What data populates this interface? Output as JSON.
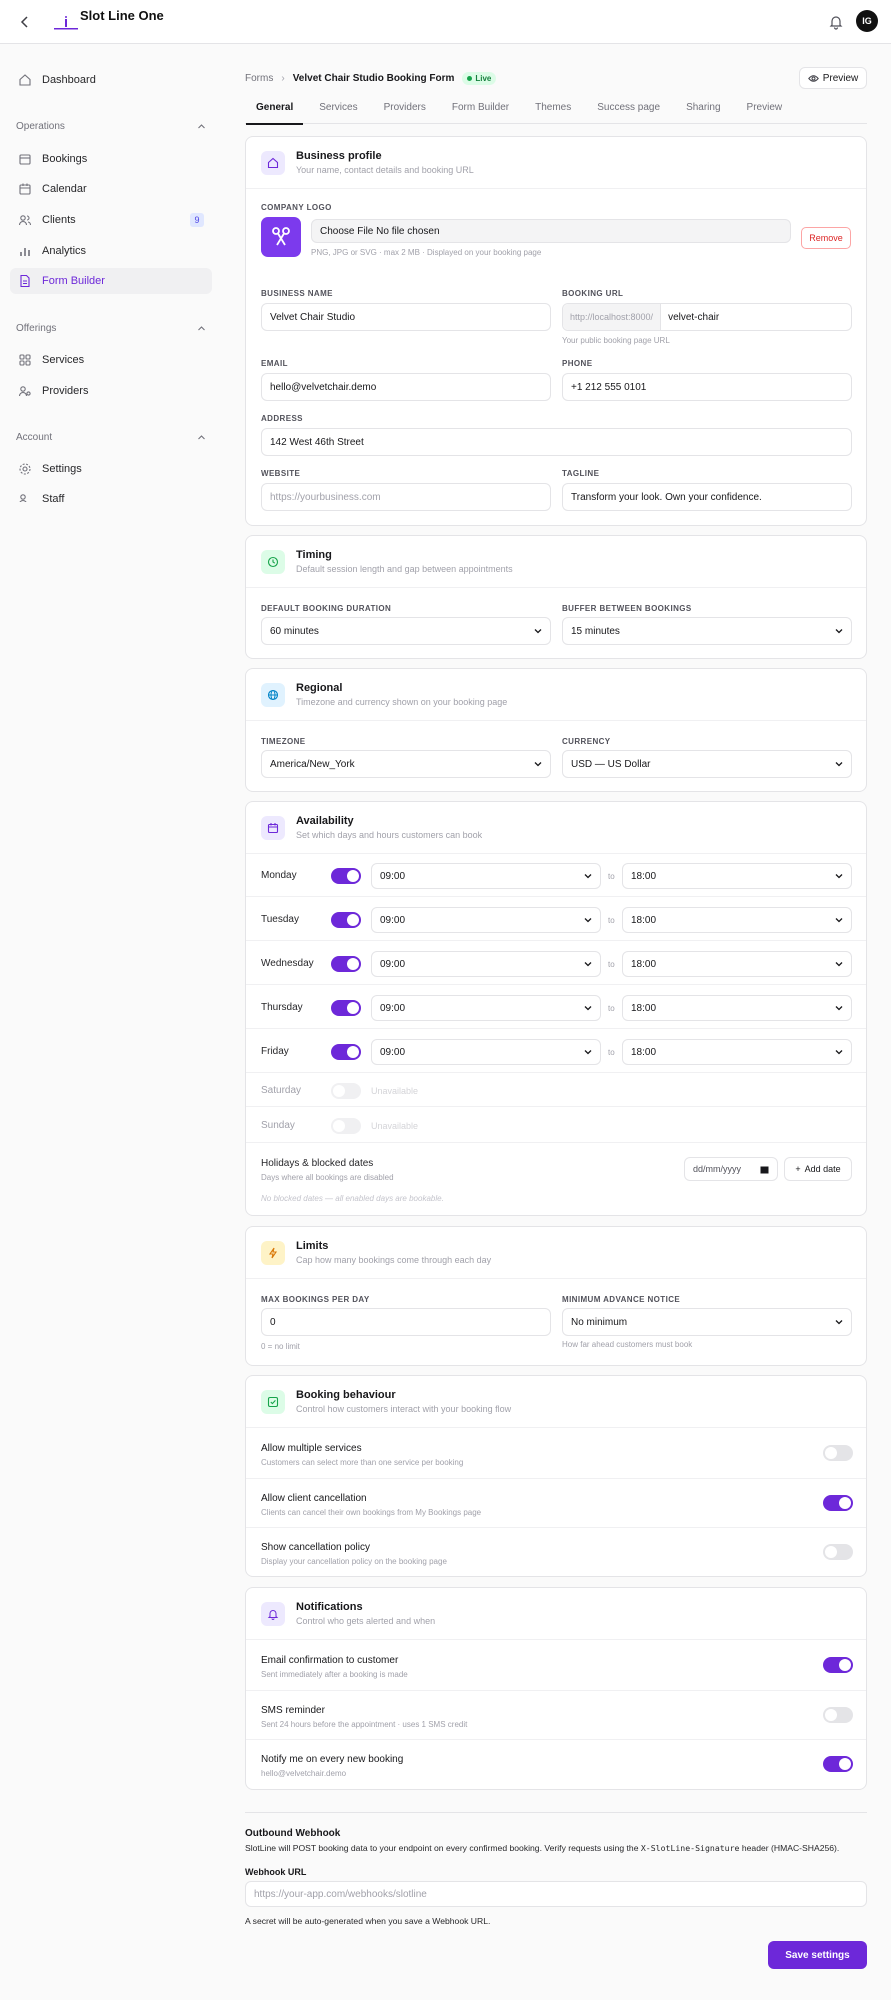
{
  "app": {
    "title": "Slot Line One",
    "avatar": "IG"
  },
  "sidebar": {
    "dashboard": "Dashboard",
    "operations": {
      "label": "Operations",
      "items": [
        {
          "label": "Bookings"
        },
        {
          "label": "Calendar"
        },
        {
          "label": "Clients",
          "badge": "9"
        },
        {
          "label": "Analytics"
        },
        {
          "label": "Form Builder"
        }
      ]
    },
    "offerings": {
      "label": "Offerings",
      "items": [
        {
          "label": "Services"
        },
        {
          "label": "Providers"
        }
      ]
    },
    "account": {
      "label": "Account",
      "items": [
        {
          "label": "Settings"
        },
        {
          "label": "Staff"
        }
      ]
    }
  },
  "header": {
    "breadcrumb_root": "Forms",
    "breadcrumb_current": "Velvet Chair Studio Booking Form",
    "status": "Live",
    "preview_button": "Preview",
    "tabs": [
      "General",
      "Services",
      "Providers",
      "Form Builder",
      "Themes",
      "Success page",
      "Sharing",
      "Preview"
    ]
  },
  "business": {
    "title": "Business profile",
    "subtitle": "Your name, contact details and booking URL",
    "logo_label": "COMPANY LOGO",
    "file_text": "Choose File No file chosen",
    "file_hint": "PNG, JPG or SVG · max 2 MB · Displayed on your booking page",
    "remove": "Remove",
    "name_label": "BUSINESS NAME",
    "name_value": "Velvet Chair Studio",
    "url_label": "BOOKING URL",
    "url_prefix": "http://localhost:8000/",
    "url_value": "velvet-chair",
    "url_hint": "Your public booking page URL",
    "email_label": "EMAIL",
    "email_value": "hello@velvetchair.demo",
    "phone_label": "PHONE",
    "phone_value": "+1 212 555 0101",
    "address_label": "ADDRESS",
    "address_value": "142 West 46th Street",
    "website_label": "WEBSITE",
    "website_placeholder": "https://yourbusiness.com",
    "tagline_label": "TAGLINE",
    "tagline_value": "Transform your look. Own your confidence."
  },
  "timing": {
    "title": "Timing",
    "subtitle": "Default session length and gap between appointments",
    "duration_label": "DEFAULT BOOKING DURATION",
    "duration_value": "60 minutes",
    "buffer_label": "BUFFER BETWEEN BOOKINGS",
    "buffer_value": "15 minutes"
  },
  "regional": {
    "title": "Regional",
    "subtitle": "Timezone and currency shown on your booking page",
    "tz_label": "TIMEZONE",
    "tz_value": "America/New_York",
    "cur_label": "CURRENCY",
    "cur_value": "USD — US Dollar"
  },
  "availability": {
    "title": "Availability",
    "subtitle": "Set which days and hours customers can book",
    "to": "to",
    "unavailable": "Unavailable",
    "days": [
      {
        "day": "Monday",
        "start": "09:00",
        "end": "18:00"
      },
      {
        "day": "Tuesday",
        "start": "09:00",
        "end": "18:00"
      },
      {
        "day": "Wednesday",
        "start": "09:00",
        "end": "18:00"
      },
      {
        "day": "Thursday",
        "start": "09:00",
        "end": "18:00"
      },
      {
        "day": "Friday",
        "start": "09:00",
        "end": "18:00"
      },
      {
        "day": "Saturday"
      },
      {
        "day": "Sunday"
      }
    ],
    "holidays_title": "Holidays & blocked dates",
    "holidays_sub": "Days where all bookings are disabled",
    "date_placeholder": "dd/mm/yyyy",
    "add_date": "Add date",
    "empty_note": "No blocked dates — all enabled days are bookable."
  },
  "limits": {
    "title": "Limits",
    "subtitle": "Cap how many bookings come through each day",
    "max_label": "MAX BOOKINGS PER DAY",
    "max_value": "0",
    "max_hint": "0 = no limit",
    "notice_label": "MINIMUM ADVANCE NOTICE",
    "notice_value": "No minimum",
    "notice_hint": "How far ahead customers must book"
  },
  "behaviour": {
    "title": "Booking behaviour",
    "subtitle": "Control how customers interact with your booking flow",
    "items": [
      {
        "title": "Allow multiple services",
        "sub": "Customers can select more than one service per booking"
      },
      {
        "title": "Allow client cancellation",
        "sub": "Clients can cancel their own bookings from My Bookings page"
      },
      {
        "title": "Show cancellation policy",
        "sub": "Display your cancellation policy on the booking page"
      }
    ]
  },
  "notifications": {
    "title": "Notifications",
    "subtitle": "Control who gets alerted and when",
    "items": [
      {
        "title": "Email confirmation to customer",
        "sub": "Sent immediately after a booking is made"
      },
      {
        "title": "SMS reminder",
        "sub": "Sent 24 hours before the appointment · uses 1 SMS credit"
      },
      {
        "title": "Notify me on every new booking",
        "sub": "hello@velvetchair.demo"
      }
    ]
  },
  "webhook": {
    "title": "Outbound Webhook",
    "desc_pre": "SlotLine will POST booking data to your endpoint on every confirmed booking. Verify requests using the ",
    "desc_code": "X-SlotLine-Signature",
    "desc_post": " header (HMAC-SHA256).",
    "url_label": "Webhook URL",
    "url_placeholder": "https://your-app.com/webhooks/slotline",
    "note": "A secret will be auto-generated when you save a Webhook URL."
  },
  "save": "Save settings",
  "colors": {
    "accent": "#6d28d9",
    "live": "#16a34a",
    "danger": "#dc2626"
  }
}
